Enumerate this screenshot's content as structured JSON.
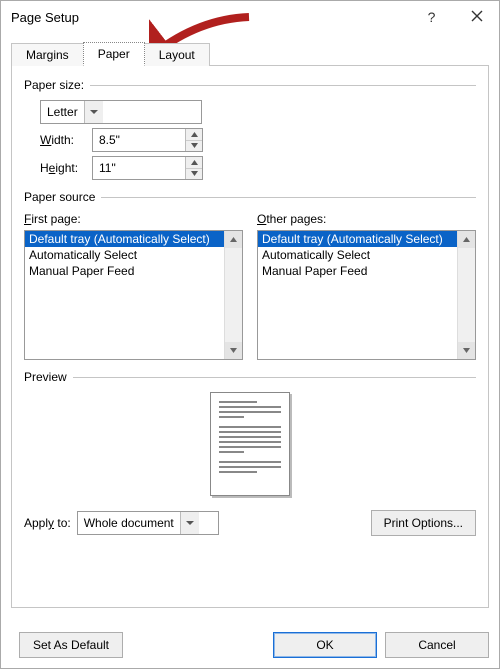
{
  "title": "Page Setup",
  "tabs": {
    "margins": "Margins",
    "paper": "Paper",
    "layout": "Layout"
  },
  "papersize": {
    "group_label": "Paper size:",
    "selected": "Letter",
    "width_label": "Width:",
    "width_value": "8.5\"",
    "height_label": "Height:",
    "height_value": "11\""
  },
  "papersource": {
    "group_label": "Paper source",
    "first_label": "First page:",
    "other_label": "Other pages:",
    "options": [
      "Default tray (Automatically Select)",
      "Automatically Select",
      "Manual Paper Feed"
    ]
  },
  "preview": {
    "label": "Preview"
  },
  "apply": {
    "label": "Apply to:",
    "value": "Whole document"
  },
  "buttons": {
    "print_options": "Print Options...",
    "set_default": "Set As Default",
    "ok": "OK",
    "cancel": "Cancel"
  }
}
